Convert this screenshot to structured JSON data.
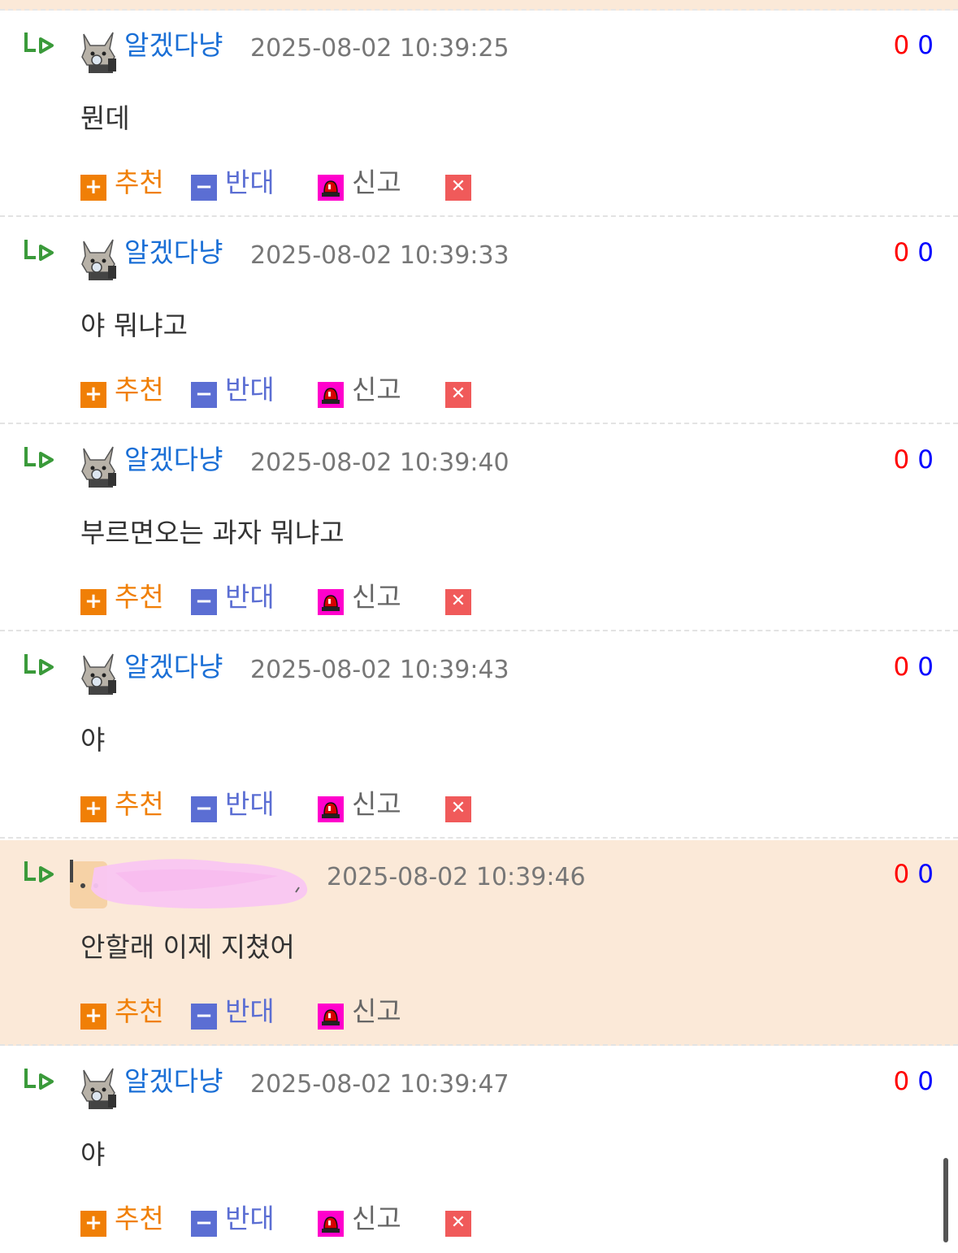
{
  "labels": {
    "recommend": "추천",
    "oppose": "반대",
    "report": "신고"
  },
  "colors": {
    "highlight_bg": "#fbe9d8",
    "nick": "#1a6fd6",
    "recommend": "#f07f06",
    "oppose": "#5b6ed3",
    "report": "#ff00cc",
    "delete": "#f05a5a"
  },
  "icons": {
    "reply": "reply-arrow-icon",
    "plus": "plus-icon",
    "minus": "minus-icon",
    "siren": "siren-icon",
    "delete": "close-icon"
  },
  "comments": [
    {
      "nickname": "알겠다냥",
      "datetime": "2025-08-02 10:39:25",
      "up": "0",
      "down": "0",
      "text": "뭔데"
    },
    {
      "nickname": "알겠다냥",
      "datetime": "2025-08-02 10:39:33",
      "up": "0",
      "down": "0",
      "text": "야 뭐냐고"
    },
    {
      "nickname": "알겠다냥",
      "datetime": "2025-08-02 10:39:40",
      "up": "0",
      "down": "0",
      "text": "부르면오는 과자 뭐냐고"
    },
    {
      "nickname": "알겠다냥",
      "datetime": "2025-08-02 10:39:43",
      "up": "0",
      "down": "0",
      "text": "야"
    },
    {
      "nickname": "",
      "datetime": "2025-08-02 10:39:46",
      "up": "0",
      "down": "0",
      "text": "안할래 이제 지쳤어"
    },
    {
      "nickname": "알겠다냥",
      "datetime": "2025-08-02 10:39:47",
      "up": "0",
      "down": "0",
      "text": "야"
    }
  ]
}
